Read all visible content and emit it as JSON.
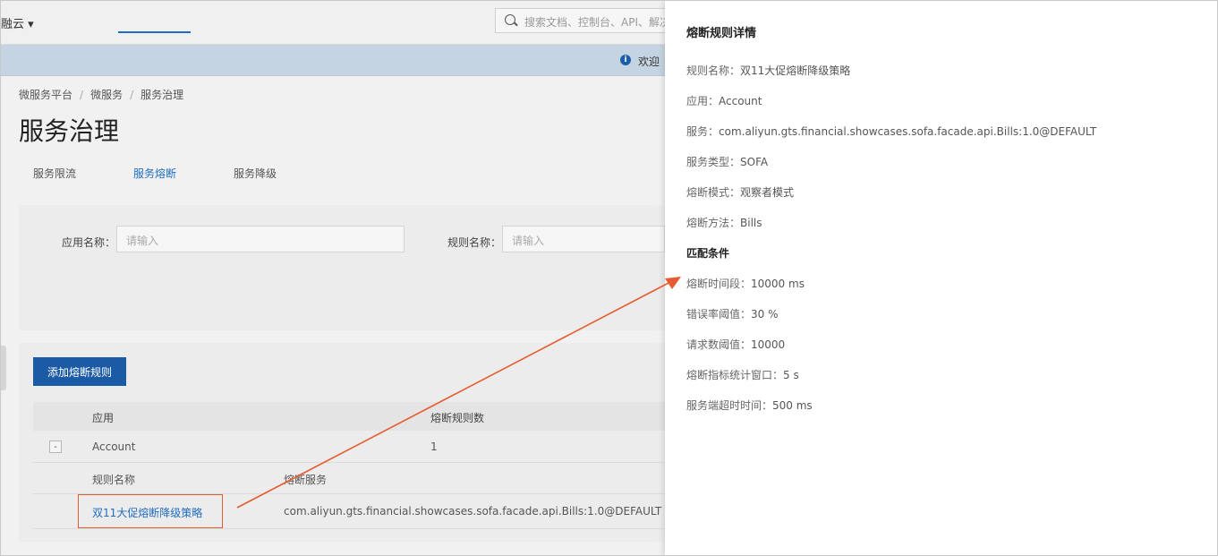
{
  "topbar": {
    "brand": "融云 ▾",
    "search_placeholder": "搜索文档、控制台、API、解决"
  },
  "notice": {
    "text": "欢迎"
  },
  "breadcrumb": [
    "微服务平台",
    "微服务",
    "服务治理"
  ],
  "page_title": "服务治理",
  "tabs": [
    {
      "label": "服务限流",
      "active": false
    },
    {
      "label": "服务熔断",
      "active": true
    },
    {
      "label": "服务降级",
      "active": false
    }
  ],
  "filters": {
    "app_label": "应用名称：",
    "app_placeholder": "请输入",
    "rule_label": "规则名称：",
    "rule_placeholder": "请输入"
  },
  "table": {
    "add_button": "添加熔断规则",
    "headers": {
      "app": "应用",
      "count": "熔断规则数"
    },
    "rows": [
      {
        "expand": "-",
        "app": "Account",
        "count": "1"
      }
    ],
    "sub_headers": {
      "rule_name": "规则名称",
      "service": "熔断服务"
    },
    "sub_rows": [
      {
        "rule_name": "双11大促熔断降级策略",
        "service": "com.aliyun.gts.financial.showcases.sofa.facade.api.Bills:1.0@DEFAULT"
      }
    ]
  },
  "drawer": {
    "title": "熔断规则详情",
    "fields": [
      {
        "key": "规则名称：",
        "value": "双11大促熔断降级策略"
      },
      {
        "key": "应用：",
        "value": "Account"
      },
      {
        "key": "服务：",
        "value": "com.aliyun.gts.financial.showcases.sofa.facade.api.Bills:1.0@DEFAULT"
      },
      {
        "key": "服务类型：",
        "value": "SOFA"
      },
      {
        "key": "熔断模式：",
        "value": "观察者模式"
      },
      {
        "key": "熔断方法：",
        "value": "Bills"
      }
    ],
    "section_title": "匹配条件",
    "conditions": [
      {
        "key": "熔断时间段：",
        "value": "10000 ms"
      },
      {
        "key": "错误率阈值：",
        "value": "30 %"
      },
      {
        "key": "请求数阈值：",
        "value": "10000"
      },
      {
        "key": "熔断指标统计窗口：",
        "value": "5 s"
      },
      {
        "key": "服务端超时时间：",
        "value": "500 ms"
      }
    ]
  },
  "colors": {
    "accent": "#1f6dc0",
    "button": "#1b5aa5",
    "annotation": "#e85a2f"
  }
}
